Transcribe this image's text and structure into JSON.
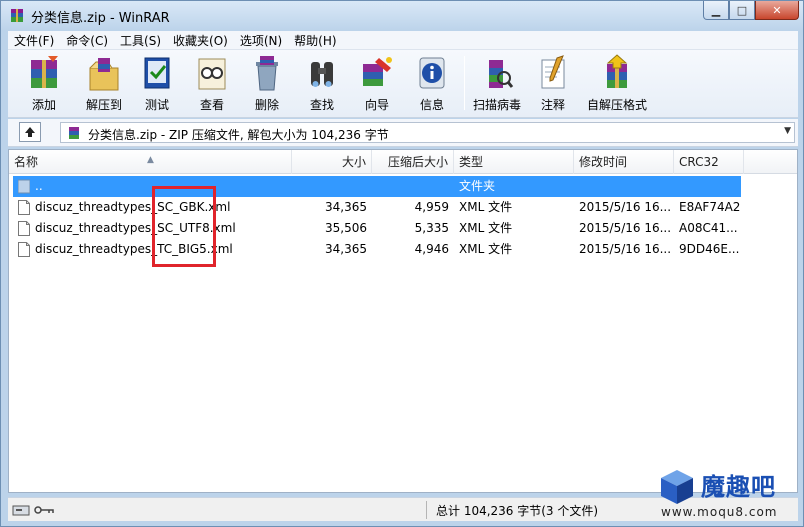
{
  "window": {
    "title": "分类信息.zip - WinRAR"
  },
  "window_buttons": {
    "minimize": "▁",
    "maximize": "□",
    "close": "✕"
  },
  "menu": [
    "文件(F)",
    "命令(C)",
    "工具(S)",
    "收藏夹(O)",
    "选项(N)",
    "帮助(H)"
  ],
  "toolbar": [
    {
      "label": "添加",
      "icon": "add-archive-icon"
    },
    {
      "label": "解压到",
      "icon": "extract-to-icon"
    },
    {
      "label": "测试",
      "icon": "test-icon"
    },
    {
      "label": "查看",
      "icon": "view-icon"
    },
    {
      "label": "删除",
      "icon": "delete-icon"
    },
    {
      "label": "查找",
      "icon": "find-icon"
    },
    {
      "label": "向导",
      "icon": "wizard-icon"
    },
    {
      "label": "信息",
      "icon": "info-icon"
    },
    {
      "label": "扫描病毒",
      "icon": "virus-scan-icon"
    },
    {
      "label": "注释",
      "icon": "comment-icon"
    },
    {
      "label": "自解压格式",
      "icon": "sfx-icon"
    }
  ],
  "address": {
    "text": "分类信息.zip - ZIP 压缩文件, 解包大小为 104,236 字节"
  },
  "columns": {
    "name": "名称",
    "size": "大小",
    "packed": "压缩后大小",
    "type": "类型",
    "modified": "修改时间",
    "crc": "CRC32"
  },
  "files": [
    {
      "name": "..",
      "size": "",
      "packed": "",
      "type": "文件夹",
      "modified": "",
      "crc": ""
    },
    {
      "name": "discuz_threadtypes_SC_GBK.xml",
      "size": "34,365",
      "packed": "4,959",
      "type": "XML 文件",
      "modified": "2015/5/16 16...",
      "crc": "E8AF74A2"
    },
    {
      "name": "discuz_threadtypes_SC_UTF8.xml",
      "size": "35,506",
      "packed": "5,335",
      "type": "XML 文件",
      "modified": "2015/5/16 16...",
      "crc": "A08C41..."
    },
    {
      "name": "discuz_threadtypes_TC_BIG5.xml",
      "size": "34,365",
      "packed": "4,946",
      "type": "XML 文件",
      "modified": "2015/5/16 16...",
      "crc": "9DD46E..."
    }
  ],
  "status": {
    "summary": "总计 104,236 字节(3 个文件)"
  },
  "watermark": {
    "brand": "魔趣吧",
    "url": "www.moqu8.com"
  },
  "colors": {
    "selection": "#3399ff",
    "highlight_box": "#e0242b",
    "title_bg": "#bcd3ea"
  }
}
